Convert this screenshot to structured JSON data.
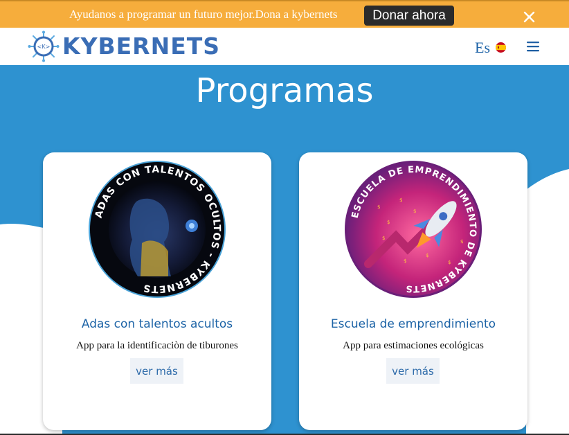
{
  "banner": {
    "text": "Ayudanos a programar un futuro mejor.Dona a kybernets",
    "donate_label": "Donar ahora",
    "close_icon": "close-icon",
    "color": "#f6ad3c"
  },
  "header": {
    "logo_badge": "<K>",
    "logo_text": "KYBERNETS",
    "language": "Es",
    "flag_icon": "spain-flag-icon",
    "menu_icon": "hamburger-menu-icon"
  },
  "hero": {
    "title": "Programas",
    "color": "#2e92d0"
  },
  "programs": [
    {
      "badge_ring_text": "ADAS CON TALENTOS OCULTOS - KYBERNETS",
      "title": "Adas con talentos acultos",
      "description": "App para la identificaciòn de tiburones",
      "button": "ver más"
    },
    {
      "badge_ring_text": "ESCUELA DE EMPRENDIMIENTO DE KYBERNETS",
      "title": "Escuela de emprendimiento",
      "description": "App para estimaciones ecológicas",
      "button": "ver más"
    }
  ]
}
